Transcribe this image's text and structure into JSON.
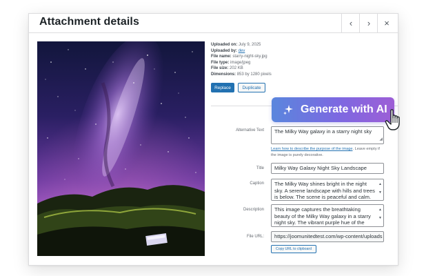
{
  "modal": {
    "title": "Attachment details",
    "prev_glyph": "‹",
    "next_glyph": "›",
    "close_glyph": "×"
  },
  "meta": {
    "uploaded_on_label": "Uploaded on:",
    "uploaded_on": "July 9, 2025",
    "uploaded_by_label": "Uploaded by:",
    "uploaded_by": "dev",
    "file_name_label": "File name:",
    "file_name": "starry-night-sky.jpg",
    "file_type_label": "File type:",
    "file_type": "image/jpeg",
    "file_size_label": "File size:",
    "file_size": "202 KB",
    "dimensions_label": "Dimensions:",
    "dimensions": "853 by 1280 pixels"
  },
  "actions": {
    "replace": "Replace",
    "duplicate": "Duplicate",
    "generate_ai": "Generate with AI",
    "copy_url": "Copy URL to clipboard"
  },
  "fields": {
    "alt_label": "Alternative Text",
    "alt_value": "The Milky Way galaxy in a starry night sky",
    "alt_help_link": "Learn how to describe the purpose of the image",
    "alt_help_rest": ". Leave empty if the image is purely decorative.",
    "title_label": "Title",
    "title_value": "Milky Way Galaxy Night Sky Landscape",
    "caption_label": "Caption",
    "caption_value": "The Milky Way shines bright in the night sky. A serene landscape with hills and trees is below. The scene is peaceful and calm. The",
    "description_label": "Description",
    "description_value": "This image captures the breathtaking beauty of the Milky Way galaxy in a starry night sky. The vibrant purple hue of the galaxy stands",
    "url_label": "File URL:",
    "url_value": "https://joomunitedtest.com/wp-content/uploads"
  },
  "colors": {
    "primary": "#2271b1",
    "ai_gradient_start": "#5a86dd",
    "ai_gradient_end": "#9d5ed6"
  },
  "icons": [
    "chevron-left-icon",
    "chevron-right-icon",
    "close-icon",
    "sparkle-icon",
    "hand-pointer-icon"
  ]
}
